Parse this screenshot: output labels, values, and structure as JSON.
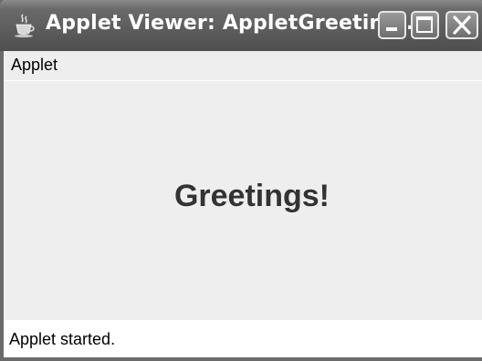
{
  "window": {
    "title": "Applet Viewer: AppletGreeting..."
  },
  "icons": {
    "app": "java-coffee-cup-icon",
    "minimize": "minimize-icon",
    "maximize": "maximize-icon",
    "close": "close-icon"
  },
  "menubar": {
    "items": [
      {
        "label": "Applet"
      }
    ]
  },
  "applet": {
    "greeting": "Greetings!"
  },
  "status": {
    "text": "Applet started."
  },
  "colors": {
    "titlebar": "#5c5c5c",
    "content_background": "#eeeeee",
    "greeting_text": "#333333",
    "status_background": "#ffffff"
  }
}
